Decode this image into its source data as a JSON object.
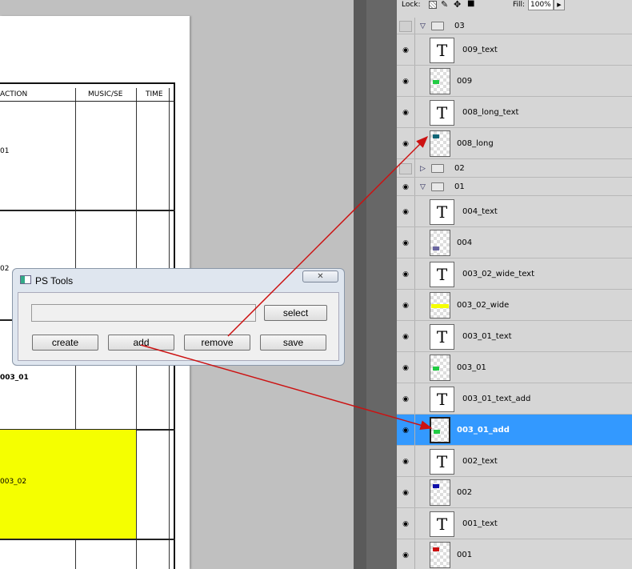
{
  "document": {
    "headers": {
      "action": "ACTION",
      "music": "MUSIC/SE",
      "time": "TIME"
    },
    "cells": [
      "01",
      "02",
      "003_01",
      "003_02"
    ],
    "highlight_color": "#f5ff00"
  },
  "layers_panel": {
    "lock_label": "Lock:",
    "fill_label": "Fill:",
    "fill_value": "100%",
    "lock_icons": [
      "lock-transparent-icon",
      "brush-icon",
      "move-icon",
      "lock-icon"
    ],
    "layers": [
      {
        "name": "03",
        "kind": "group",
        "expanded": true,
        "visible": false
      },
      {
        "name": "009_text",
        "kind": "text",
        "visible": true
      },
      {
        "name": "009",
        "kind": "pixel",
        "visible": true,
        "swatch": "#22cc44"
      },
      {
        "name": "008_long_text",
        "kind": "text",
        "visible": true
      },
      {
        "name": "008_long",
        "kind": "pixel",
        "visible": true,
        "swatch": "#116677"
      },
      {
        "name": "02",
        "kind": "group",
        "expanded": false,
        "visible": false
      },
      {
        "name": "01",
        "kind": "group",
        "expanded": true,
        "visible": true
      },
      {
        "name": "004_text",
        "kind": "text",
        "visible": true
      },
      {
        "name": "004",
        "kind": "pixel",
        "visible": true,
        "swatch": "#6a66a0"
      },
      {
        "name": "003_02_wide_text",
        "kind": "text",
        "visible": true
      },
      {
        "name": "003_02_wide",
        "kind": "pixel",
        "visible": true,
        "swatch": "#f5ff00"
      },
      {
        "name": "003_01_text",
        "kind": "text",
        "visible": true
      },
      {
        "name": "003_01",
        "kind": "pixel",
        "visible": true,
        "swatch": "#22cc44"
      },
      {
        "name": "003_01_text_add",
        "kind": "text",
        "visible": true
      },
      {
        "name": "003_01_add",
        "kind": "pixel",
        "visible": true,
        "swatch": "#22cc44",
        "selected": true
      },
      {
        "name": "002_text",
        "kind": "text",
        "visible": true
      },
      {
        "name": "002",
        "kind": "pixel",
        "visible": true,
        "swatch": "#1111aa"
      },
      {
        "name": "001_text",
        "kind": "text",
        "visible": true
      },
      {
        "name": "001",
        "kind": "pixel",
        "visible": true,
        "swatch": "#cc1111"
      }
    ]
  },
  "dialog": {
    "title": "PS Tools",
    "close_glyph": "✕",
    "path_value": "",
    "buttons": {
      "select": "select",
      "create": "create",
      "add": "add",
      "remove": "remove",
      "save": "save"
    }
  },
  "colors": {
    "selection": "#3399ff",
    "arrow": "#cc1111"
  }
}
